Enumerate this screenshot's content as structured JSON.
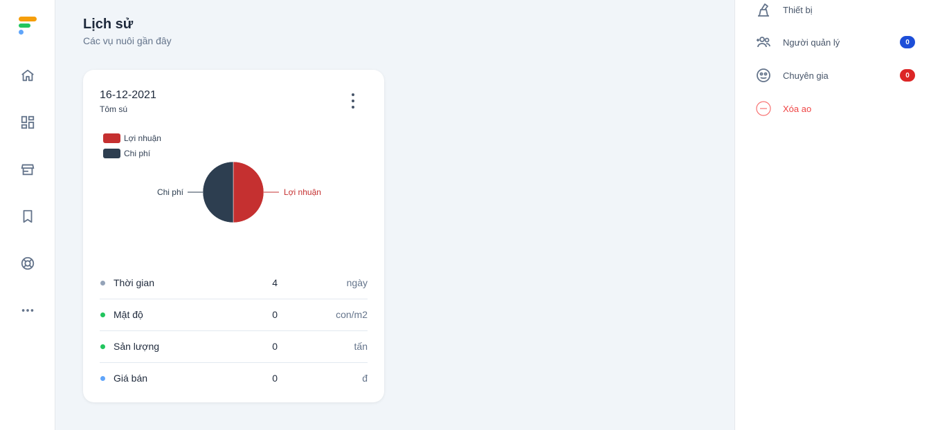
{
  "nav": {
    "items": [
      {
        "icon": "home-icon"
      },
      {
        "icon": "dashboard-icon"
      },
      {
        "icon": "store-icon"
      },
      {
        "icon": "bookmark-icon"
      },
      {
        "icon": "support-icon"
      },
      {
        "icon": "more-icon"
      }
    ]
  },
  "main": {
    "title": "Lịch sử",
    "subtitle": "Các vụ nuôi gần đây"
  },
  "card": {
    "date": "16-12-2021",
    "species": "Tôm sú",
    "legend": [
      {
        "label": "Lợi nhuận",
        "color": "#c53030"
      },
      {
        "label": "Chi phí",
        "color": "#2d3e50"
      }
    ],
    "stats": [
      {
        "label": "Thời gian",
        "value": "4",
        "unit": "ngày",
        "dot_color": "#94a3b8"
      },
      {
        "label": "Mật độ",
        "value": "0",
        "unit": "con/m2",
        "dot_color": "#22c55e"
      },
      {
        "label": "Sản lượng",
        "value": "0",
        "unit": "tấn",
        "dot_color": "#22c55e"
      },
      {
        "label": "Giá bán",
        "value": "0",
        "unit": "đ",
        "dot_color": "#60a5fa"
      }
    ]
  },
  "chart_data": {
    "type": "pie",
    "categories": [
      "Lợi nhuận",
      "Chi phí"
    ],
    "values": [
      50,
      50
    ],
    "colors": [
      "#c53030",
      "#2d3e50"
    ],
    "legend_position": "top-left"
  },
  "right_panel": {
    "items": [
      {
        "label": "Thiết bị",
        "icon": "device-icon"
      },
      {
        "label": "Người quản lý",
        "icon": "managers-icon",
        "badge": "0",
        "badge_color": "#1d4ed8"
      },
      {
        "label": "Chuyên gia",
        "icon": "expert-icon",
        "badge": "0",
        "badge_color": "#dc2626"
      },
      {
        "label": "Xóa ao",
        "icon": "remove-icon",
        "color": "#ef4444"
      }
    ]
  }
}
